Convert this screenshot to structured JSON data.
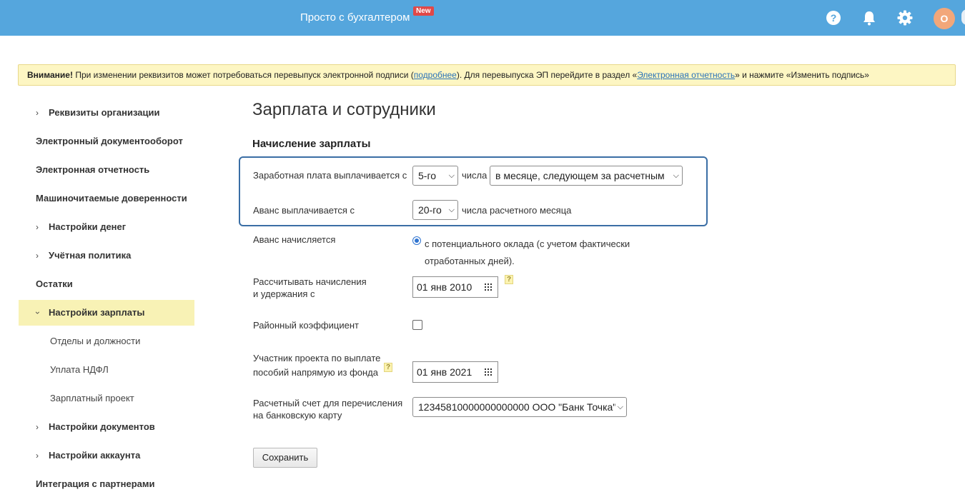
{
  "header": {
    "brand": "Просто с бухгалтером",
    "new_badge": "New",
    "help_icon": "question-circle-icon",
    "notifications_icon": "bell-icon",
    "settings_icon": "gear-icon",
    "avatar_letter": "О",
    "accent_color": "#55a6dd"
  },
  "warning": {
    "bold": "Внимание!",
    "text1": " При изменении реквизитов может потребоваться перевыпуск электронной подписи (",
    "link1": "подробнее",
    "text2": "). Для перевыпуска ЭП перейдите в раздел «",
    "link2": "Электронная отчетность",
    "text3": "» и нажмите «Изменить подпись»"
  },
  "sidebar": {
    "items": [
      {
        "label": "Реквизиты организации"
      },
      {
        "label": "Электронный документооборот"
      },
      {
        "label": "Электронная отчетность"
      },
      {
        "label": "Машиночитаемые доверенности"
      },
      {
        "label": "Настройки денег"
      },
      {
        "label": "Учётная политика"
      },
      {
        "label": "Остатки"
      },
      {
        "label": "Настройки зарплаты"
      },
      {
        "label": "Отделы и должности"
      },
      {
        "label": "Уплата НДФЛ"
      },
      {
        "label": "Зарплатный проект"
      },
      {
        "label": "Настройки документов"
      },
      {
        "label": "Настройки аккаунта"
      },
      {
        "label": "Интеграция с партнерами"
      }
    ]
  },
  "main": {
    "title": "Зарплата и сотрудники",
    "section": "Начисление зарплаты",
    "salary_label": "Заработная плата выплачивается с",
    "salary_day": "5-го",
    "salary_day_suffix": "числа",
    "salary_month": "в месяце, следующем за расчетным",
    "advance_label": "Аванс выплачивается с",
    "advance_day": "20-го",
    "advance_suffix": "числа расчетного месяца",
    "advance_calc_label": "Аванс начисляется",
    "advance_calc_option_line1": "с потенциального оклада (с учетом фактически",
    "advance_calc_option_line2": "отработанных дней).",
    "calc_from_label_line1": "Рассчитывать начисления",
    "calc_from_label_line2": "и удержания с",
    "calc_from_date": "01 янв 2010",
    "regional_label": "Районный коэффициент",
    "project_label_line1": "Участник проекта по выплате",
    "project_label_line2": "пособий напрямую из фонда",
    "project_date": "01 янв 2021",
    "account_label_line1": "Расчетный счет для перечисления",
    "account_label_line2": "на банковскую карту",
    "account_value": "12345810000000000000 ООО \"Банк Точка\"",
    "save_label": "Сохранить",
    "help_mark": "?"
  }
}
